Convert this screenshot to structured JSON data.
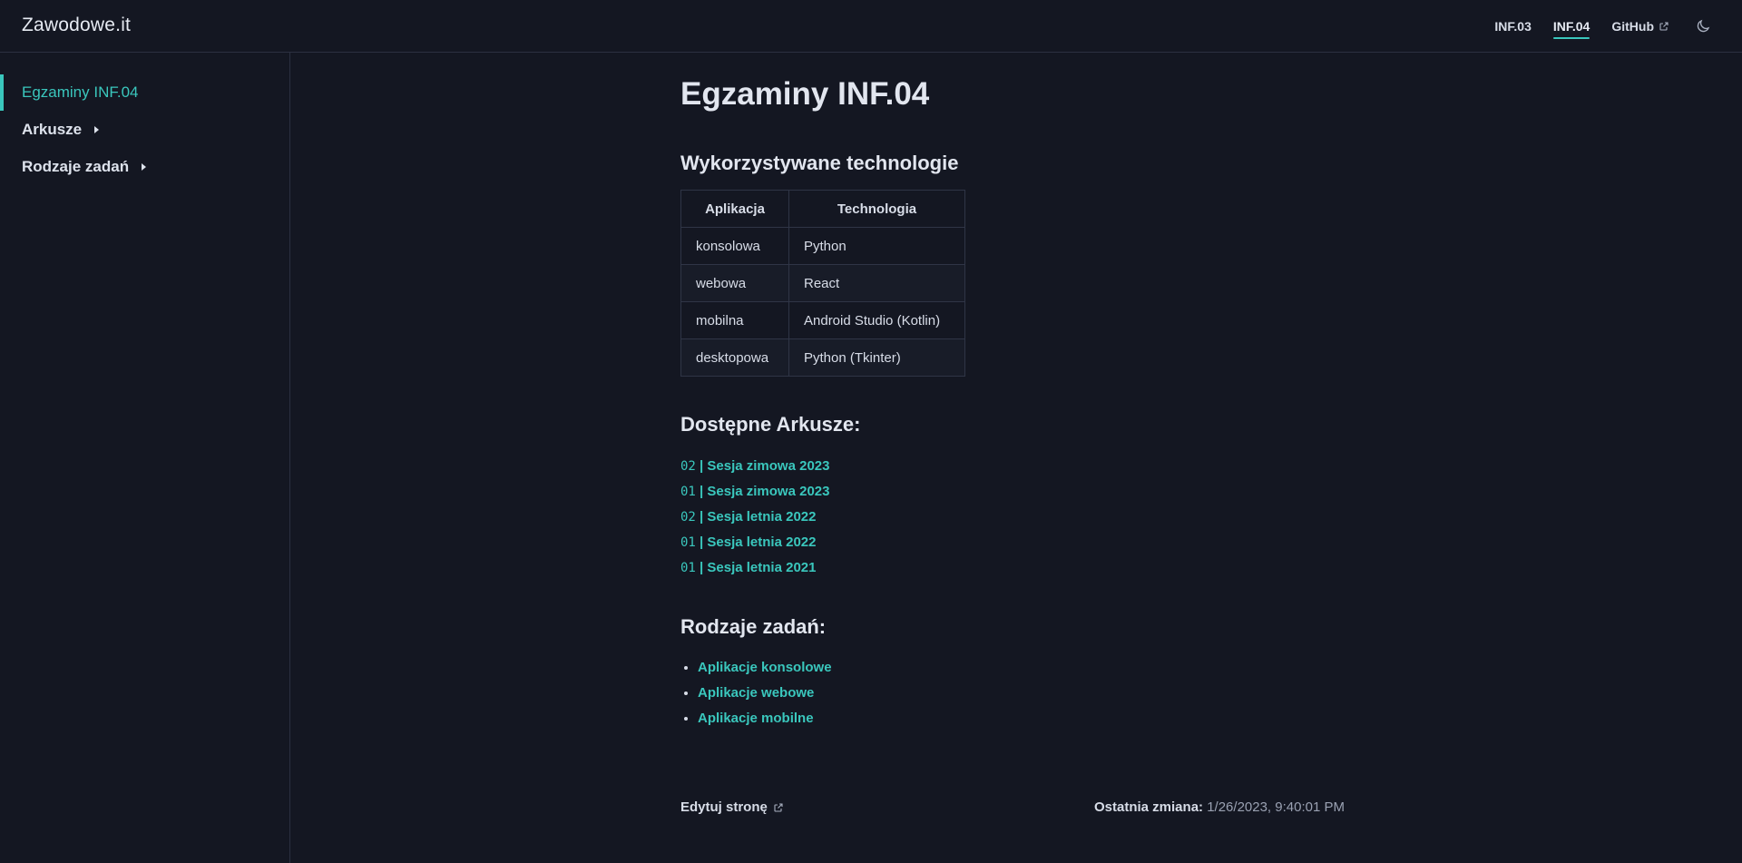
{
  "header": {
    "brand": "Zawodowe.it",
    "links": [
      {
        "label": "INF.03",
        "active": false
      },
      {
        "label": "INF.04",
        "active": true
      },
      {
        "label": "GitHub",
        "external": true
      }
    ],
    "theme_toggle_icon": "moon-icon"
  },
  "sidebar": {
    "items": [
      {
        "label": "Egzaminy INF.04",
        "active": true
      },
      {
        "label": "Arkusze",
        "collapsible": true
      },
      {
        "label": "Rodzaje zadań",
        "collapsible": true
      }
    ]
  },
  "main": {
    "title": "Egzaminy INF.04",
    "tech_heading": "Wykorzystywane technologie",
    "tech_table": {
      "headers": [
        "Aplikacja",
        "Technologia"
      ],
      "rows": [
        [
          "konsolowa",
          "Python"
        ],
        [
          "webowa",
          "React"
        ],
        [
          "mobilna",
          "Android Studio (Kotlin)"
        ],
        [
          "desktopowa",
          "Python (Tkinter)"
        ]
      ]
    },
    "sheets_heading": "Dostępne Arkusze:",
    "sheets": [
      {
        "code": "02",
        "label": "| Sesja zimowa 2023"
      },
      {
        "code": "01",
        "label": "| Sesja zimowa 2023"
      },
      {
        "code": "02",
        "label": "| Sesja letnia 2022"
      },
      {
        "code": "01",
        "label": "| Sesja letnia 2022"
      },
      {
        "code": "01",
        "label": "| Sesja letnia 2021"
      }
    ],
    "tasks_heading": "Rodzaje zadań:",
    "tasks": [
      "Aplikacje konsolowe",
      "Aplikacje webowe",
      "Aplikacje mobilne"
    ]
  },
  "footer": {
    "edit_label": "Edytuj stronę",
    "updated_label": "Ostatnia zmiana:",
    "updated_value": "1/26/2023, 9:40:01 PM"
  },
  "colors": {
    "background": "#141722",
    "accent": "#3ac7bd",
    "border": "#2b3040"
  }
}
